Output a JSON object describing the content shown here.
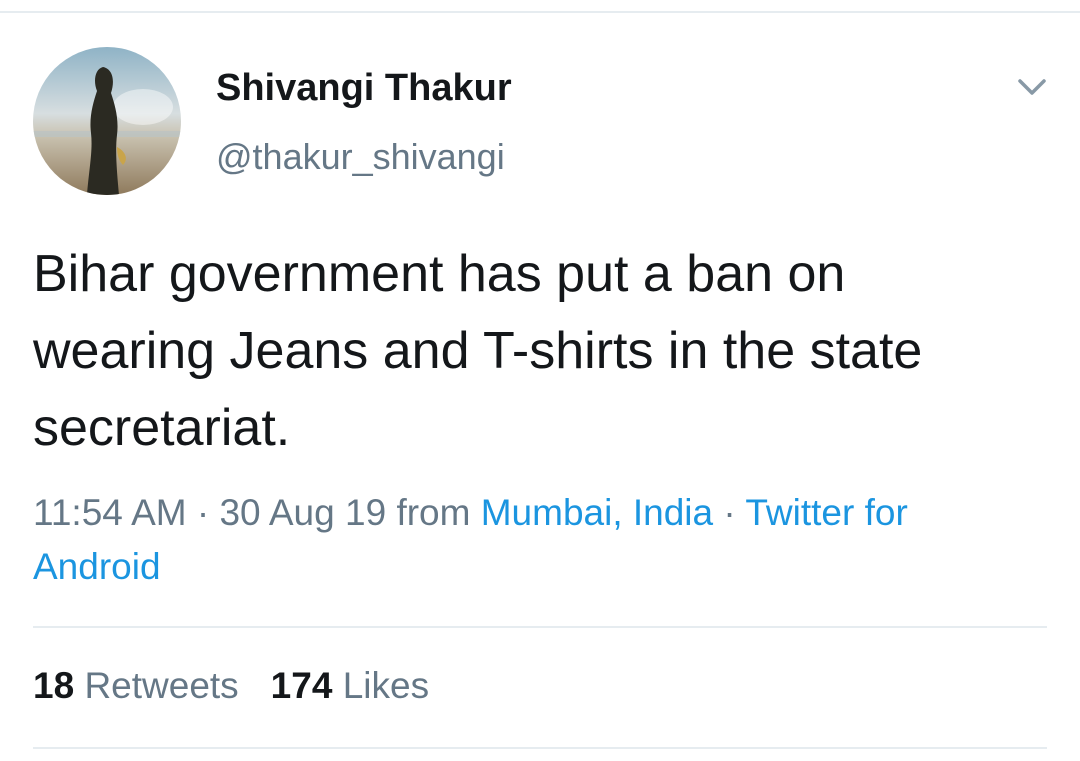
{
  "user": {
    "display_name": "Shivangi Thakur",
    "handle": "@thakur_shivangi"
  },
  "tweet": {
    "text": "Bihar government has put a ban on wearing Jeans and T-shirts in the state secretariat.",
    "time": "11:54 AM",
    "separator": "·",
    "date": "30 Aug 19",
    "from_label": "from",
    "location": "Mumbai, India",
    "source": "Twitter for Android"
  },
  "stats": {
    "retweets_count": "18",
    "retweets_label": "Retweets",
    "likes_count": "174",
    "likes_label": "Likes"
  },
  "colors": {
    "text_primary": "#14171a",
    "text_secondary": "#657786",
    "link": "#1b95e0",
    "divider": "#e6ecf0"
  },
  "icons": {
    "caret": "chevron-down-icon"
  }
}
